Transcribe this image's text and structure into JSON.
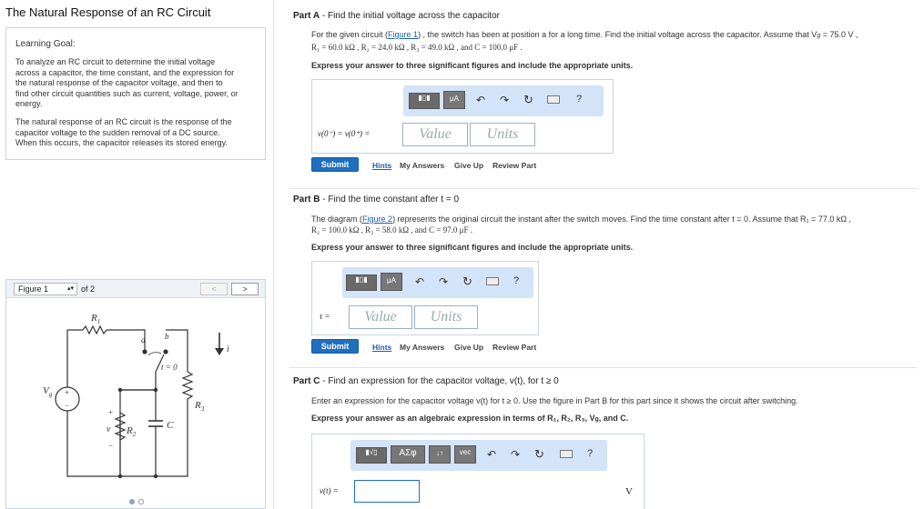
{
  "page": {
    "title": "The Natural Response of an RC Circuit"
  },
  "learning_goal": {
    "heading": "Learning Goal:",
    "para1_lines": [
      "To analyze an RC circuit to determine the initial voltage",
      "across a capacitor, the time constant, and the expression for",
      "the natural response of the capacitor voltage, and then to",
      "find other circuit quantities such as current, voltage, power, or",
      "energy."
    ],
    "para2_lines": [
      "The natural response of an RC circuit is the response of the",
      "capacitor voltage to the sudden removal of a DC source.",
      "When this occurs, the capacitor releases its stored energy."
    ]
  },
  "figure": {
    "select_value": "Figure 1",
    "of_text": "of 2",
    "prev_label": "<",
    "next_label": ">",
    "labels": {
      "r1": "R",
      "r1_sub": "1",
      "r2": "R",
      "r2_sub": "2",
      "r3": "R",
      "r3_sub": "3",
      "a": "a",
      "b": "b",
      "t0": "t = 0",
      "vg": "V",
      "vg_sub": "g",
      "v": "v",
      "c": "C",
      "i": "i",
      "plus": "+",
      "minus": "−"
    }
  },
  "partA": {
    "label": "Part A",
    "title": " - Find the initial voltage across the capacitor",
    "line1_pre": "For the given circuit (",
    "fig_link": "Figure 1",
    "line1_post": ") , the switch has been at position a for a long time. Find the initial voltage across the capacitor. Assume that  V",
    "line1_end": " = 75.0 V ,",
    "line2": "R₁ = 60.0 kΩ , R₂ = 24.0 kΩ , R₃ = 49.0 kΩ , and C = 100.0 μF .",
    "instruction": "Express your answer to three significant figures and include the appropriate units.",
    "eq_label": "v(0⁻) = v(0⁺) =",
    "value_ph": "Value",
    "units_ph": "Units"
  },
  "partB": {
    "label": "Part B",
    "title": " - Find the time constant after t = 0",
    "line1_pre": "The diagram (",
    "fig_link": "Figure 2",
    "line1_post": ") represents the original circuit the instant after the switch moves. Find the time constant after t = 0. Assume that R₁ = 77.0 kΩ ,",
    "line2": "R₂ = 100.0 kΩ , R₃ = 58.0 kΩ , and C = 97.0 μF .",
    "instruction": "Express your answer to three significant figures and include the appropriate units.",
    "eq_label": "τ =",
    "value_ph": "Value",
    "units_ph": "Units"
  },
  "partC": {
    "label": "Part C",
    "title": " - Find an expression for the capacitor voltage, v(t), for t ≥ 0",
    "line1": "Enter an expression for the capacitor voltage v(t) for t ≥ 0. Use the figure in Part B for this part since it shows the circuit after switching.",
    "instruction": "Express your answer as an algebraic expression in terms of R₁, R₂, R₃, V",
    "instruction_end": ", and C.",
    "eq_label": "v(t) =",
    "unit": "V"
  },
  "toolbar": {
    "mu": "μA",
    "greek": "ΑΣφ",
    "vec": "vec",
    "help": "?",
    "arrows": "↓↑"
  },
  "actions": {
    "submit": "Submit",
    "hints": "Hints",
    "my_answers": "My Answers",
    "give_up": "Give Up",
    "review": "Review Part"
  }
}
